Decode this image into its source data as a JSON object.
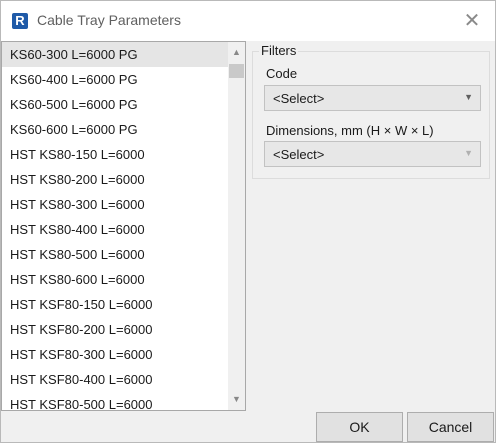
{
  "window": {
    "title": "Cable Tray Parameters",
    "app_icon_letter": "R",
    "close_glyph": "✕"
  },
  "list": {
    "items": [
      {
        "label": "KS60-300 L=6000 PG",
        "selected": true
      },
      {
        "label": "KS60-400 L=6000 PG"
      },
      {
        "label": "KS60-500 L=6000 PG"
      },
      {
        "label": "KS60-600 L=6000 PG"
      },
      {
        "label": "HST KS80-150 L=6000"
      },
      {
        "label": "HST KS80-200 L=6000"
      },
      {
        "label": "HST KS80-300 L=6000"
      },
      {
        "label": "HST KS80-400 L=6000"
      },
      {
        "label": "HST KS80-500 L=6000"
      },
      {
        "label": "HST KS80-600 L=6000"
      },
      {
        "label": "HST KSF80-150 L=6000"
      },
      {
        "label": "HST KSF80-200 L=6000"
      },
      {
        "label": "HST KSF80-300 L=6000"
      },
      {
        "label": "HST KSF80-400 L=6000"
      },
      {
        "label": "HST KSF80-500 L=6000"
      }
    ],
    "scroll_up_icon": "chevron-up-icon",
    "scroll_down_icon": "chevron-down-icon"
  },
  "filters": {
    "legend": "Filters",
    "code_label": "Code",
    "code_value": "<Select>",
    "dimensions_label": "Dimensions, mm (H × W × L)",
    "dimensions_value": "<Select>"
  },
  "buttons": {
    "ok": "OK",
    "cancel": "Cancel"
  },
  "colors": {
    "app_icon": "#1f5aa8",
    "selected_row": "#e5e5e5"
  }
}
